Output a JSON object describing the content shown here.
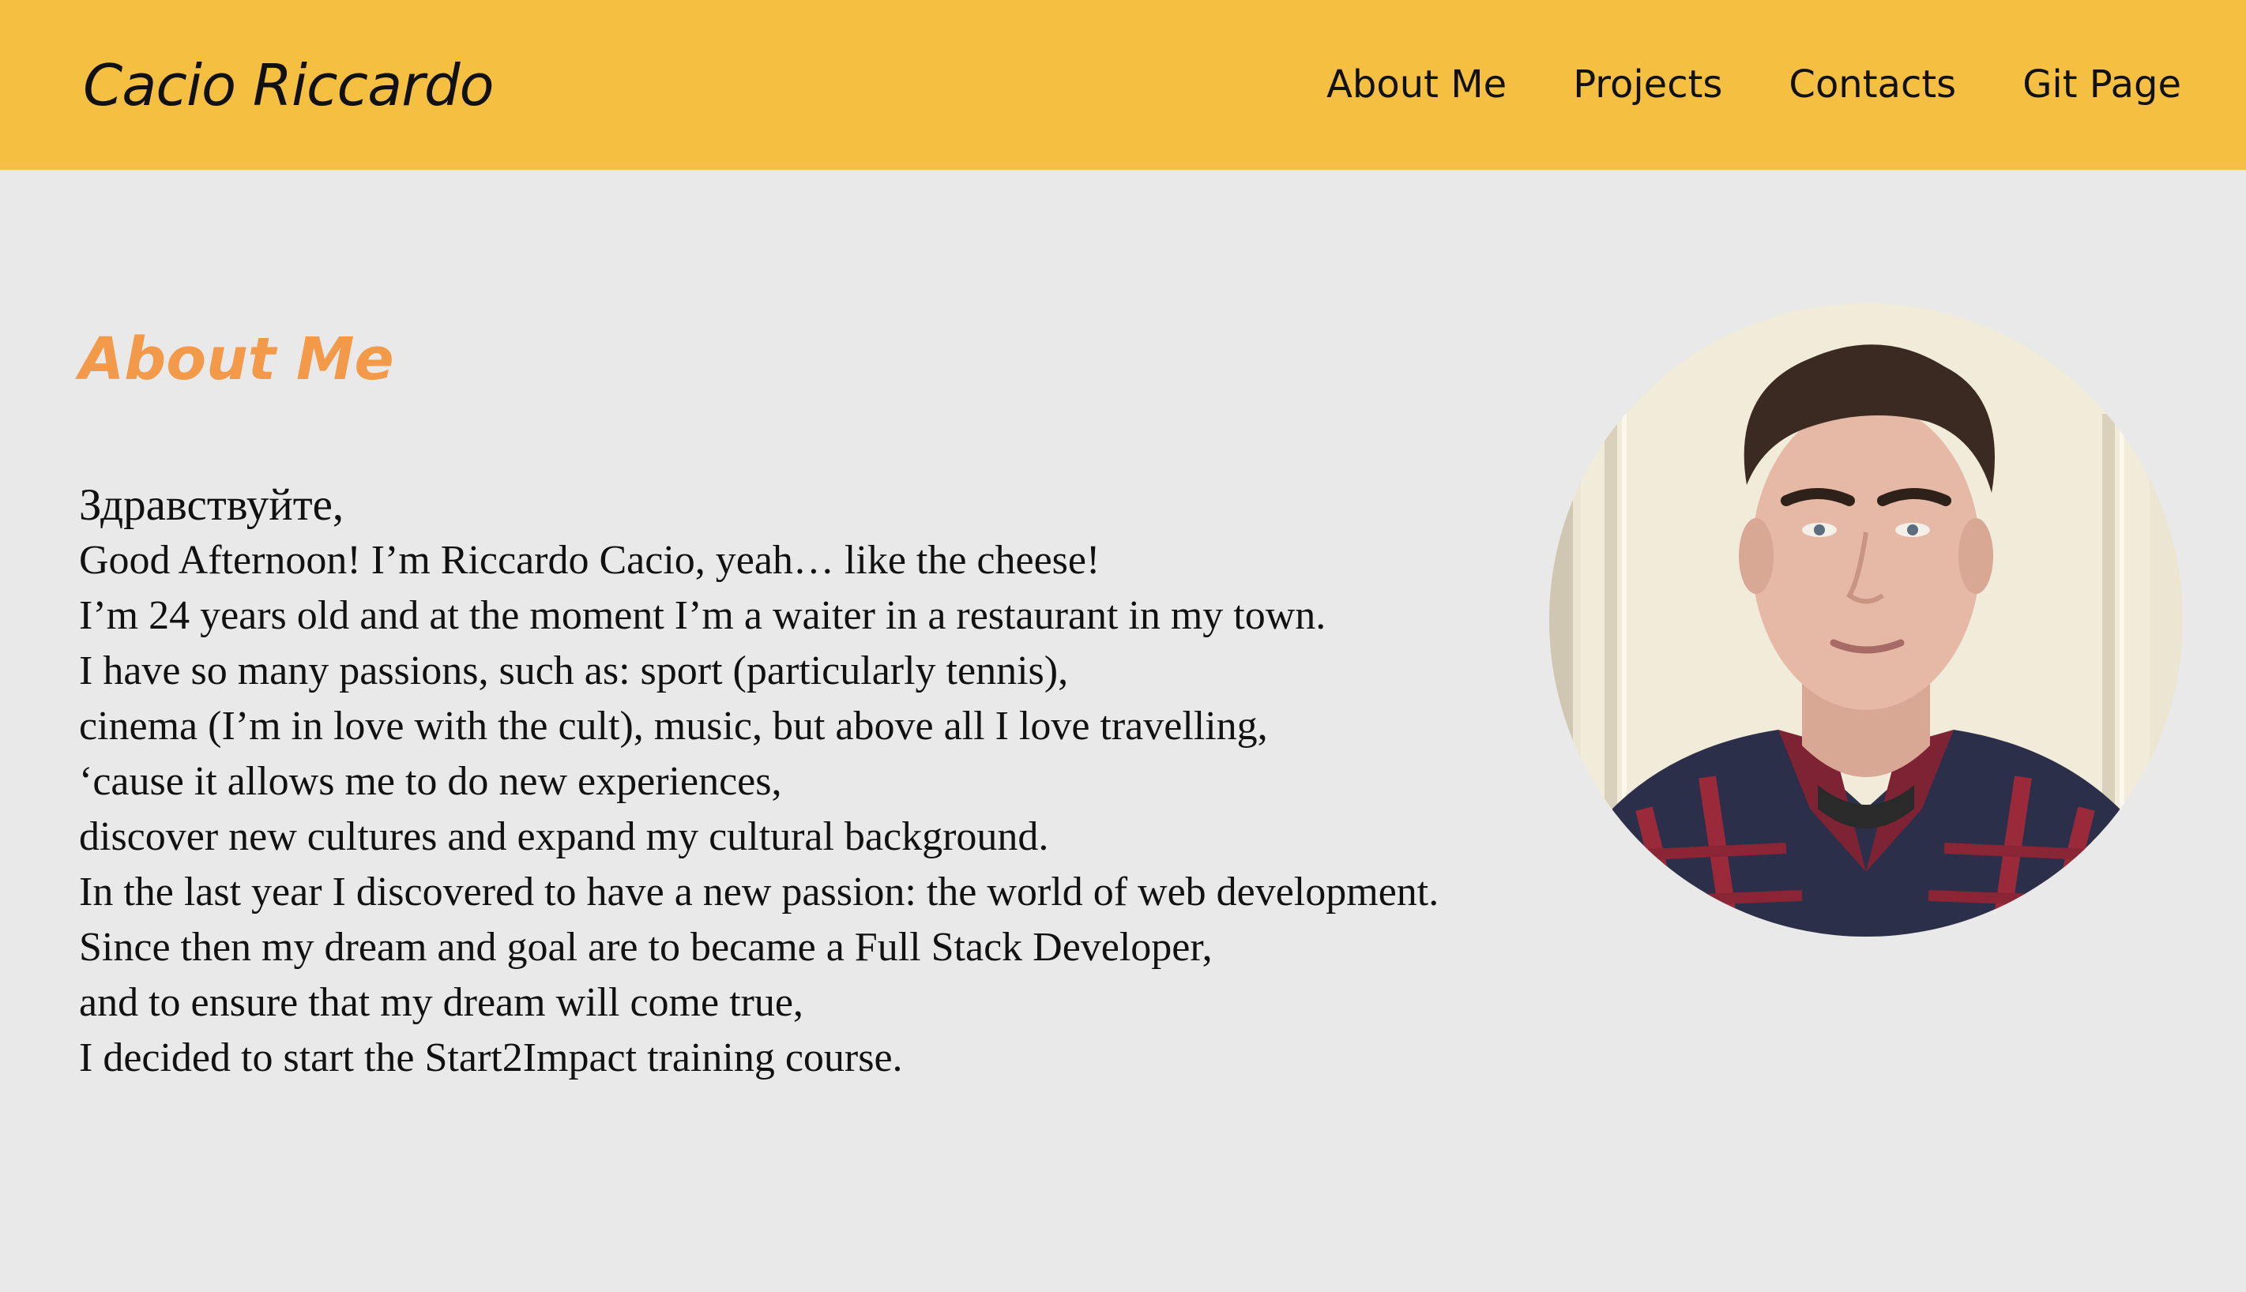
{
  "header": {
    "logo": "Cacio Riccardo",
    "nav": [
      {
        "label": "About Me"
      },
      {
        "label": "Projects"
      },
      {
        "label": "Contacts"
      },
      {
        "label": "Git Page"
      }
    ]
  },
  "main": {
    "title": "About Me",
    "bio_lines": [
      "Здравствуйте,",
      "Good Afternoon! I’m Riccardo Cacio, yeah… like the cheese!",
      "I’m 24 years old and at the moment I’m a waiter in a restaurant in my town.",
      "I have so many passions, such as: sport (particularly tennis),",
      "cinema (I’m in love with the cult), music, but above all I love travelling,",
      "‘cause it allows me to do new experiences,",
      "discover new cultures and expand my cultural background.",
      "In the last year I discovered to have a new passion: the world of web development.",
      "Since then my dream and goal are to became a Full Stack Developer,",
      "and to ensure that my dream will come true,",
      "I decided to start the Start2Impact training course."
    ]
  },
  "colors": {
    "header_bg": "#f5bf42",
    "page_bg": "#e9e9e9",
    "accent": "#f2994a",
    "text": "#111111"
  }
}
